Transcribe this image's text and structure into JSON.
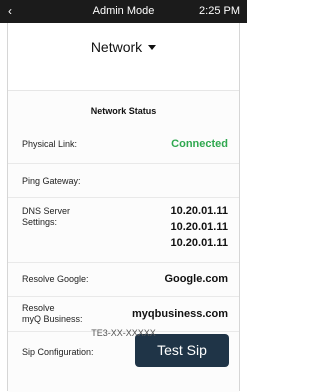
{
  "topbar": {
    "back_icon": "‹",
    "title": "Admin Mode",
    "time": "2:25 PM"
  },
  "menu": {
    "label": "Network"
  },
  "panel": {
    "title": "Network Status",
    "physical_link": {
      "label": "Physical Link:",
      "value": "Connected",
      "value_color": "#2fa84f"
    },
    "ping_gateway": {
      "label": "Ping Gateway:"
    },
    "dns": {
      "label_line1": "DNS Server",
      "label_line2": "Settings:",
      "values": [
        "10.20.01.11",
        "10.20.01.11",
        "10.20.01.11"
      ]
    },
    "resolve_google": {
      "label": "Resolve Google:",
      "value": "Google.com"
    },
    "resolve_myq": {
      "label_line1": "Resolve",
      "label_line2": "myQ Business:",
      "value": "myqbusiness.com"
    },
    "sip": {
      "label": "Sip Configuration:",
      "button": "Test Sip"
    }
  },
  "footer": {
    "device_id": "TE3-XX-XXXXX"
  }
}
